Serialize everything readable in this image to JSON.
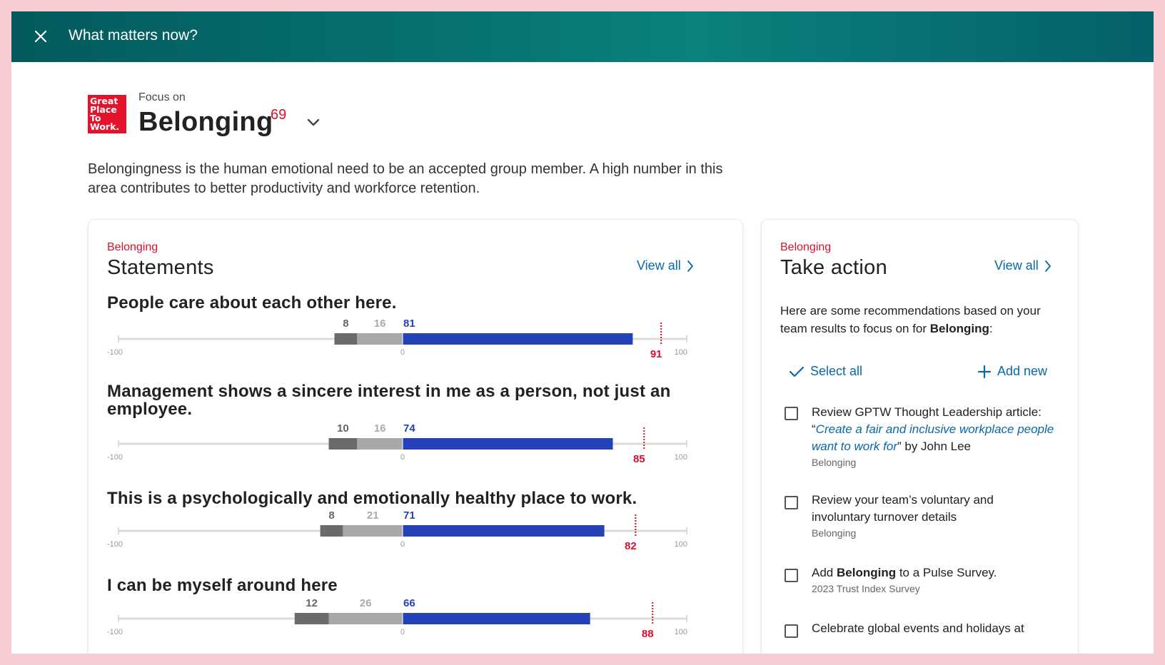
{
  "topbar": {
    "title": "What matters now?"
  },
  "logo": {
    "lines": [
      "Great",
      "Place",
      "To",
      "Work."
    ]
  },
  "focus": {
    "label": "Focus on",
    "title": "Belonging",
    "score": "69",
    "description": "Belongingness is the human emotional need to be an accepted group member. A high number in this area contributes to better productivity and workforce retention."
  },
  "statements": {
    "eyebrow": "Belonging",
    "title": "Statements",
    "view_all": "View all",
    "axis": {
      "min_label": "-100",
      "zero_label": "0",
      "max_label": "100"
    },
    "colors": {
      "negative": "#6b6b6b",
      "neutral": "#a8a8a8",
      "positive": "#2541b8",
      "benchmark": "#d8102d",
      "track": "#dcdcdc"
    },
    "items": [
      {
        "text": "People care about each other here.",
        "negative": 8,
        "neutral": 16,
        "positive": 81,
        "benchmark": 91
      },
      {
        "text": "Management shows a sincere interest in me as a person, not just an employee.",
        "negative": 10,
        "neutral": 16,
        "positive": 74,
        "benchmark": 85
      },
      {
        "text": "This is a psychologically and emotionally healthy place to work.",
        "negative": 8,
        "neutral": 21,
        "positive": 71,
        "benchmark": 82
      },
      {
        "text": "I can be myself around here",
        "negative": 12,
        "neutral": 26,
        "positive": 66,
        "benchmark": 88
      }
    ]
  },
  "actions": {
    "eyebrow": "Belonging",
    "title": "Take action",
    "view_all": "View all",
    "intro_prefix": "Here are some recommendations based on your team results to focus on for ",
    "intro_bold": "Belonging",
    "intro_suffix": ":",
    "select_all": "Select all",
    "add_new": "Add new",
    "items": [
      {
        "prefix": "Review GPTW Thought Leadership article: “",
        "link": "Create a fair and inclusive workplace people want to work for",
        "suffix": "” by John Lee",
        "sub": "Belonging"
      },
      {
        "text": "Review your team’s voluntary and involuntary turnover details",
        "sub": "Belonging"
      },
      {
        "prefix": "Add ",
        "bold": "Belonging",
        "suffix": " to a Pulse Survey.",
        "sub": "2023 Trust Index Survey"
      },
      {
        "text": "Celebrate global events and holidays at"
      }
    ]
  }
}
